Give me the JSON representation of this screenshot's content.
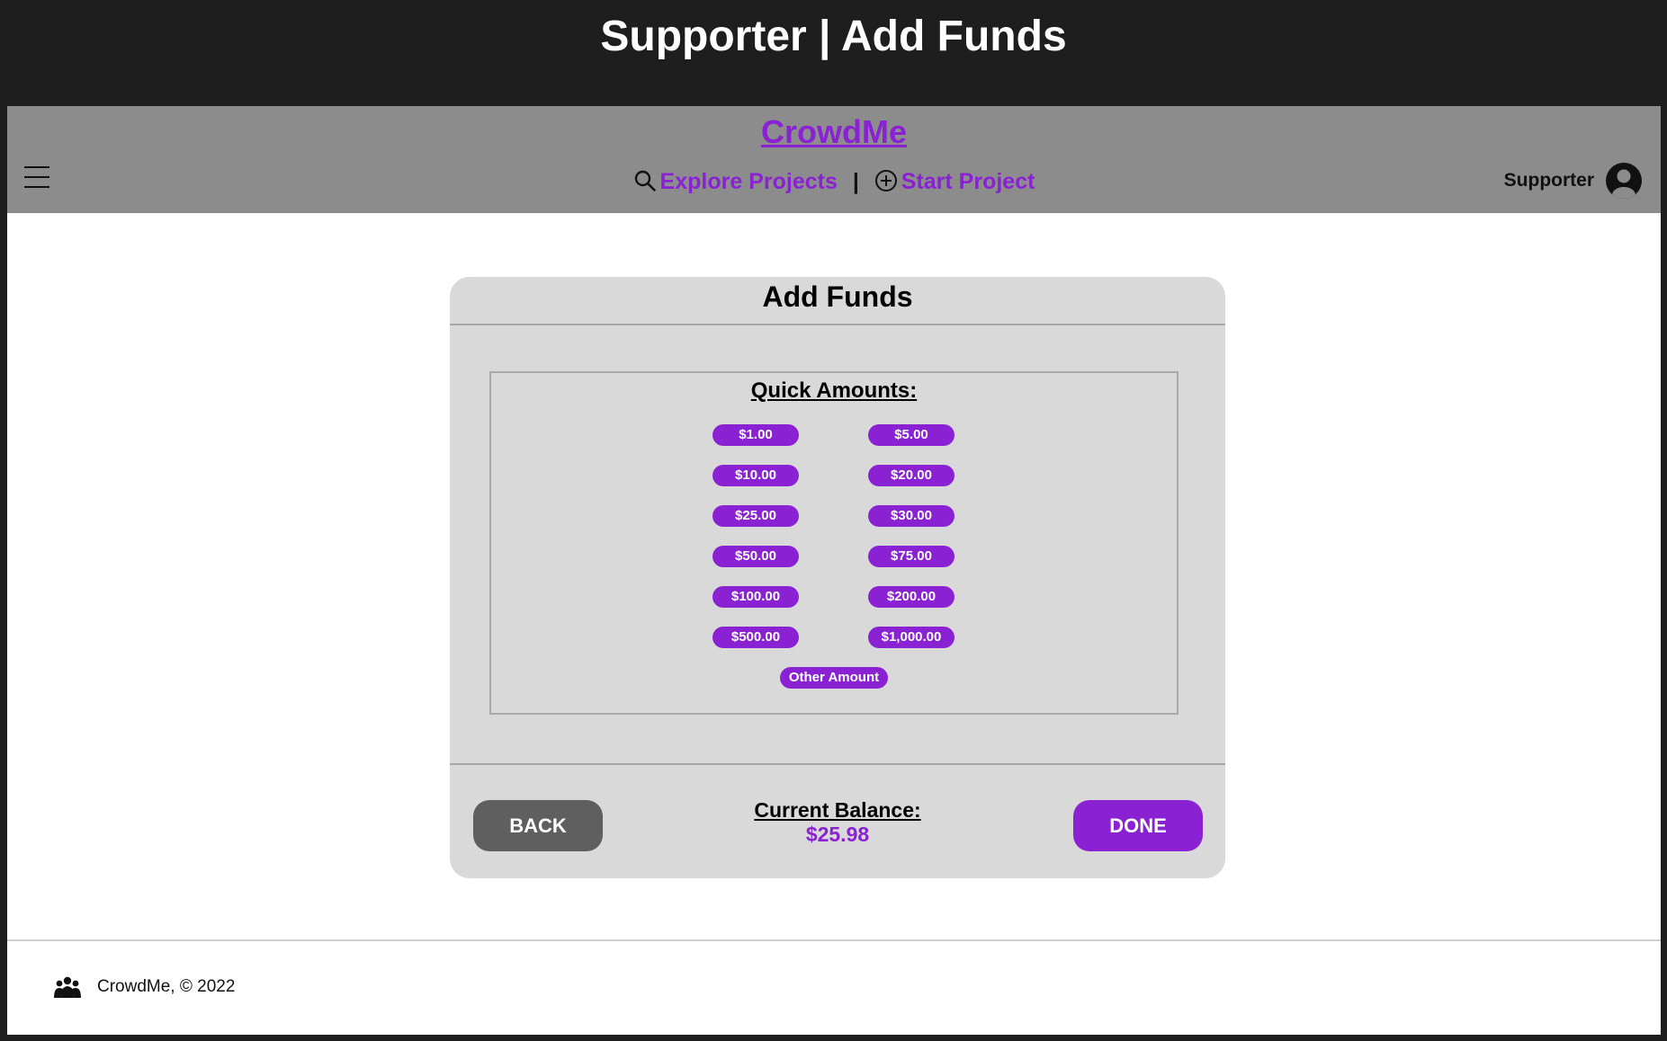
{
  "page": {
    "title": "Supporter | Add Funds"
  },
  "navbar": {
    "brand": "CrowdMe",
    "explore_label": "Explore Projects",
    "separator": "|",
    "start_label": "Start Project",
    "user_label": "Supporter",
    "icons": [
      "menu-icon",
      "search-icon",
      "plus-circle-icon",
      "user-avatar-icon"
    ]
  },
  "card": {
    "title": "Add Funds",
    "quick_title": "Quick Amounts:",
    "amounts": [
      "$1.00",
      "$5.00",
      "$10.00",
      "$20.00",
      "$25.00",
      "$30.00",
      "$50.00",
      "$75.00",
      "$100.00",
      "$200.00",
      "$500.00",
      "$1,000.00"
    ],
    "other_label": "Other Amount",
    "back_label": "BACK",
    "done_label": "DONE",
    "balance_label": "Current Balance:",
    "balance_value": "$25.98"
  },
  "footer": {
    "text": "CrowdMe, © 2022",
    "icon": "people-icon"
  },
  "colors": {
    "accent": "#8a22d4",
    "navbar": "#8c8c8c",
    "card": "#d9d9d9",
    "back": "#5f5f5f",
    "outer": "#1e1e1e"
  }
}
